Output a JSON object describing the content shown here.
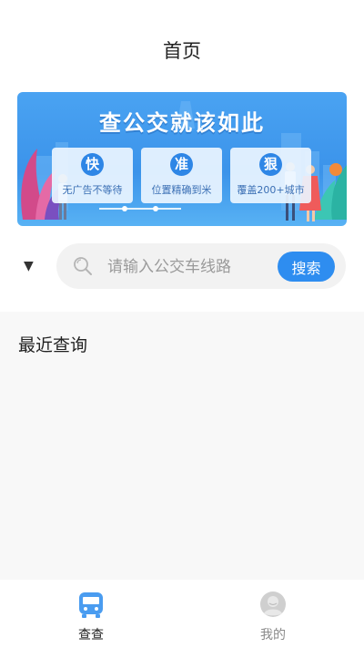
{
  "header": {
    "title": "首页"
  },
  "banner": {
    "title": "查公交就该如此",
    "features": [
      {
        "badge": "快",
        "text": "无广告不等待"
      },
      {
        "badge": "准",
        "text": "位置精确到米"
      },
      {
        "badge": "狠",
        "text": "覆盖200+城市"
      }
    ]
  },
  "search": {
    "dropdown_icon": "▼",
    "placeholder": "请输入公交车线路",
    "value": "",
    "button_label": "搜索"
  },
  "recent": {
    "title": "最近查询"
  },
  "tabbar": {
    "tabs": [
      {
        "label": "查查",
        "icon": "bus-icon",
        "active": true
      },
      {
        "label": "我的",
        "icon": "user-icon",
        "active": false
      }
    ]
  },
  "colors": {
    "accent": "#2e8df0",
    "banner_bg": "#3b93ea",
    "tab_active_icon": "#4a9cf0",
    "tab_inactive_icon": "#cccccc"
  }
}
